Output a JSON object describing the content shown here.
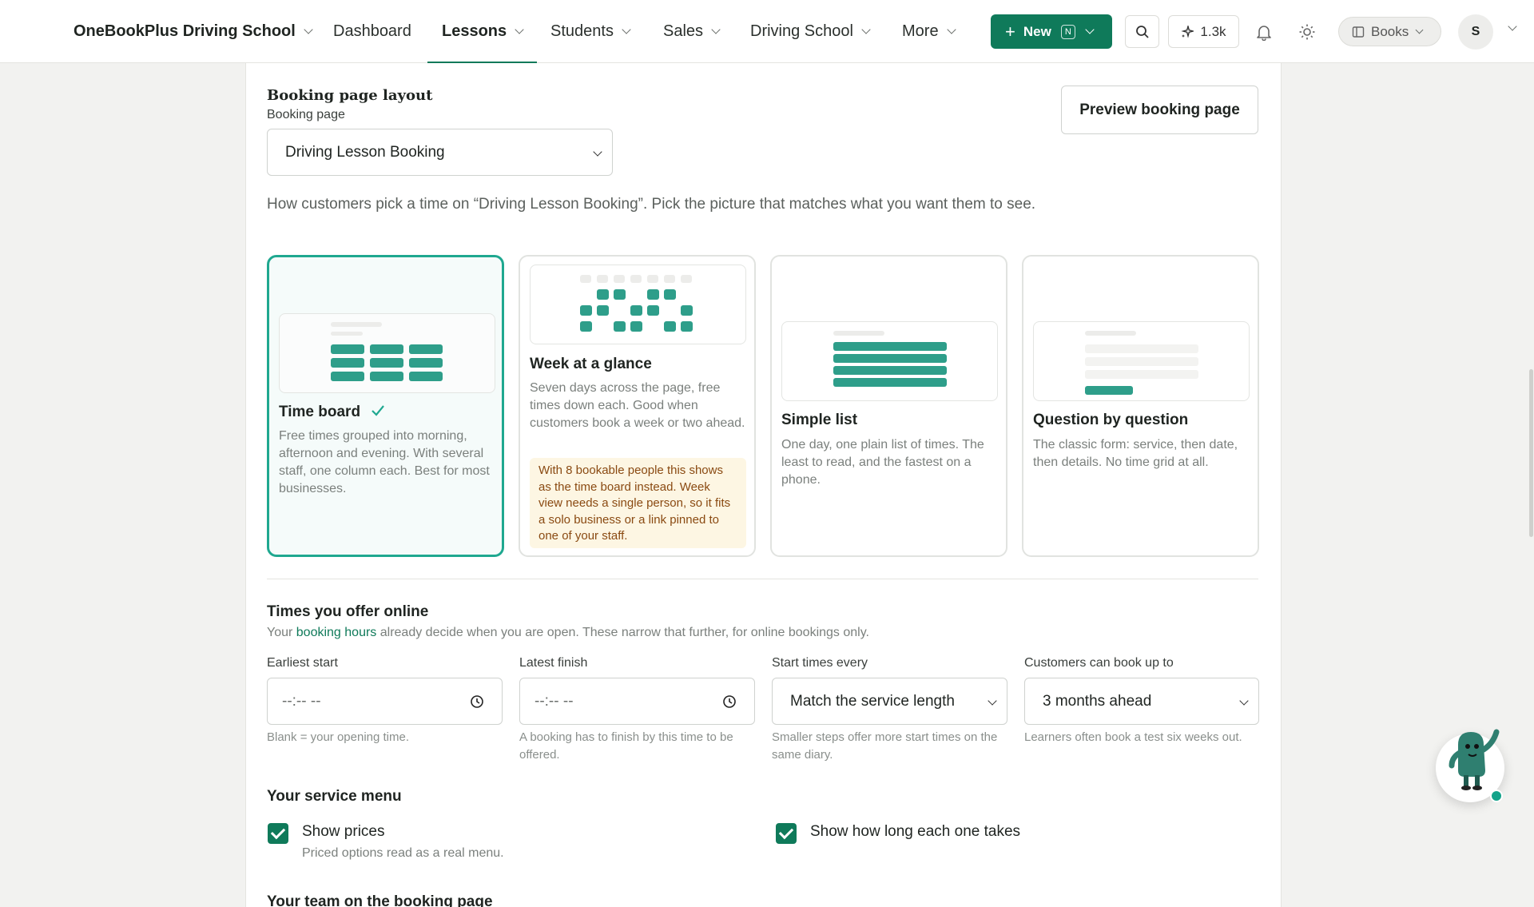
{
  "nav": {
    "brand": "OneBookPlus Driving School",
    "items": [
      "Dashboard",
      "Lessons",
      "Students",
      "Sales",
      "Driving School",
      "More"
    ],
    "active": "Lessons",
    "new_label": "New",
    "new_shortcut": "N",
    "credits": "1.3k",
    "books_label": "Books",
    "avatar_initial": "S"
  },
  "layout": {
    "title": "Booking page layout",
    "booking_page_label": "Booking page",
    "booking_page_value": "Driving Lesson Booking",
    "preview_button": "Preview booking page",
    "description": "How customers pick a time on “Driving Lesson Booking”. Pick the picture that matches what you want them to see.",
    "options": [
      {
        "title": "Time board",
        "selected": true,
        "desc": "Free times grouped into morning, afternoon and evening. With several staff, one column each. Best for most businesses."
      },
      {
        "title": "Week at a glance",
        "selected": false,
        "desc": "Seven days across the page, free times down each. Good when customers book a week or two ahead.",
        "note": "With 8 bookable people this shows as the time board instead. Week view needs a single person, so it fits a solo business or a link pinned to one of your staff."
      },
      {
        "title": "Simple list",
        "selected": false,
        "desc": "One day, one plain list of times. The least to read, and the fastest on a phone."
      },
      {
        "title": "Question by question",
        "selected": false,
        "desc": "The classic form: service, then date, then details. No time grid at all."
      }
    ]
  },
  "times": {
    "title": "Times you offer online",
    "sub_prefix": "Your ",
    "sub_link": "booking hours",
    "sub_suffix": " already decide when you are open. These narrow that further, for online bookings only.",
    "fields": [
      {
        "label": "Earliest start",
        "value": "--:-- --",
        "help": "Blank = your opening time."
      },
      {
        "label": "Latest finish",
        "value": "--:-- --",
        "help": "A booking has to finish by this time to be offered."
      },
      {
        "label": "Start times every",
        "value": "Match the service length",
        "help": "Smaller steps offer more start times on the same diary."
      },
      {
        "label": "Customers can book up to",
        "value": "3 months ahead",
        "help": "Learners often book a test six weeks out."
      }
    ]
  },
  "menu": {
    "title": "Your service menu",
    "show_prices": "Show prices",
    "show_prices_help": "Priced options read as a real menu.",
    "show_duration": "Show how long each one takes"
  },
  "team": {
    "title": "Your team on the booking page"
  },
  "colors": {
    "brand_green": "#0f7a5a",
    "accent_teal": "#2e9e8a",
    "selected_border": "#1fa890"
  }
}
